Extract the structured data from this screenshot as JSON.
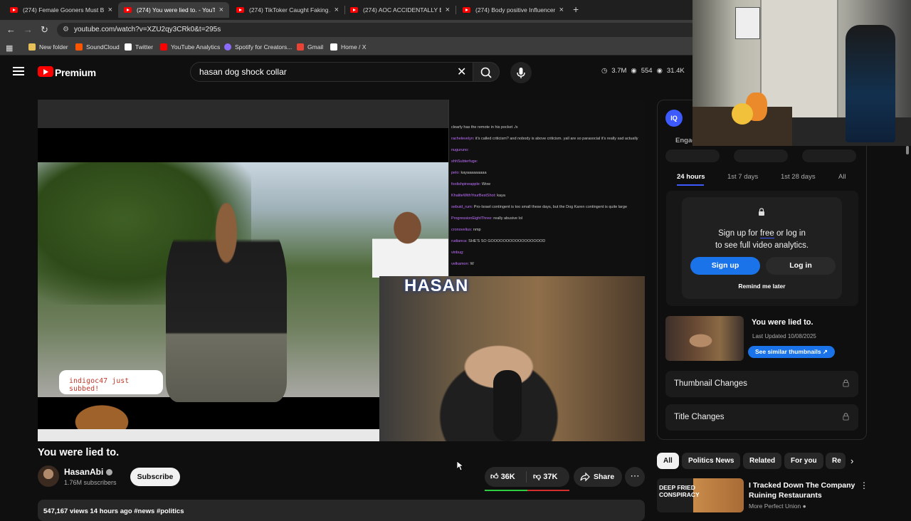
{
  "browser": {
    "tabs": [
      {
        "label": "(274) Female Gooners Must Be",
        "active": false
      },
      {
        "label": "(274) You were lied to. - YouTub",
        "active": true
      },
      {
        "label": "(274) TikToker Caught Faking A",
        "active": false
      },
      {
        "label": "(274) AOC ACCIDENTALLY Expo",
        "active": false
      },
      {
        "label": "(274) Body positive Influencers",
        "active": false
      }
    ],
    "url": "youtube.com/watch?v=XZU2qy3CRk0&t=295s",
    "bookmarks": [
      {
        "label": "New folder",
        "icon": "folder-icon",
        "color": "#e8c05a"
      },
      {
        "label": "SoundCloud",
        "icon": "soundcloud-icon",
        "color": "#ff5500"
      },
      {
        "label": "Twitter",
        "icon": "x-icon",
        "color": "#ffffff"
      },
      {
        "label": "YouTube Analytics",
        "icon": "youtube-icon",
        "color": "#ff0000"
      },
      {
        "label": "Spotify for Creators...",
        "icon": "spotify-icon",
        "color": "#8c6cff"
      },
      {
        "label": "Gmail",
        "icon": "gmail-icon",
        "color": "#ea4335"
      },
      {
        "label": "Home / X",
        "icon": "x-icon",
        "color": "#ffffff"
      }
    ]
  },
  "header": {
    "brand": "Premium",
    "search_query": "hasan dog shock collar",
    "stats": [
      "3.7M",
      "554",
      "31.4K"
    ]
  },
  "video": {
    "title": "You were lied to.",
    "channel": "HasanAbi",
    "subscribers": "1.76M subscribers",
    "subscribe_label": "Subscribe",
    "likes": "36K",
    "dislikes": "37K",
    "like_ratio": 0.5,
    "share_label": "Share",
    "meta": "547,167 views  14 hours ago  #news #politics",
    "overlay_hasan": "HASAN",
    "overlay_subbed": "indigoc47 just subbed!",
    "chat_lines": [
      {
        "user": "",
        "text": "clearly has the remote in his pocket ./s"
      },
      {
        "user": "rachelevelyn:",
        "text": "it's called criticism? and nobody is above criticism. yall are so parasocial it's really sad actually"
      },
      {
        "user": "nuguruno:",
        "text": ""
      },
      {
        "user": "shhSubterfuge:",
        "text": ""
      },
      {
        "user": "pelo:",
        "text": "kayaaaaaaaaa"
      },
      {
        "user": "foolishpineapple:",
        "text": "Wow"
      },
      {
        "user": "KhaliteWithYourBestShot:",
        "text": "kaya"
      },
      {
        "user": "sebuid_rum:",
        "text": "Pro-Israel contingent is too small these days, but the Dog Karen contingent is quite large"
      },
      {
        "user": "ProgressionEightThree:",
        "text": "really abusive lol"
      },
      {
        "user": "cronovelius:",
        "text": "nmp"
      },
      {
        "user": "rudianca:",
        "text": "SHE'S SO GOOOOOOOOOOOOOOOOOD"
      },
      {
        "user": "vinbug:",
        "text": ""
      },
      {
        "user": "velkamon:",
        "text": "W"
      }
    ]
  },
  "analytics": {
    "logo": "IQ",
    "engagement_label": "Engag",
    "time_tabs": [
      "24 hours",
      "1st 7 days",
      "1st 28 days",
      "All"
    ],
    "signup_line1_a": "Sign up for ",
    "signup_line1_free": "free",
    "signup_line1_b": " or log in",
    "signup_line2": "to see full video analytics.",
    "signup_label": "Sign up",
    "login_label": "Log in",
    "remind_label": "Remind me later",
    "thumb_title": "You were lied to.",
    "thumb_updated": "Last Updated 10/08/2025",
    "similar_label": "See similar thumbnails",
    "sections": [
      "Thumbnail Changes",
      "Title Changes"
    ]
  },
  "chips": [
    "All",
    "Politics News",
    "Related",
    "For you",
    "Re"
  ],
  "related": {
    "thumb_text": "DEEP FRIED CONSPIRACY",
    "title": "I Tracked Down The Company Ruining Restaurants",
    "channel": "More Perfect Union"
  }
}
